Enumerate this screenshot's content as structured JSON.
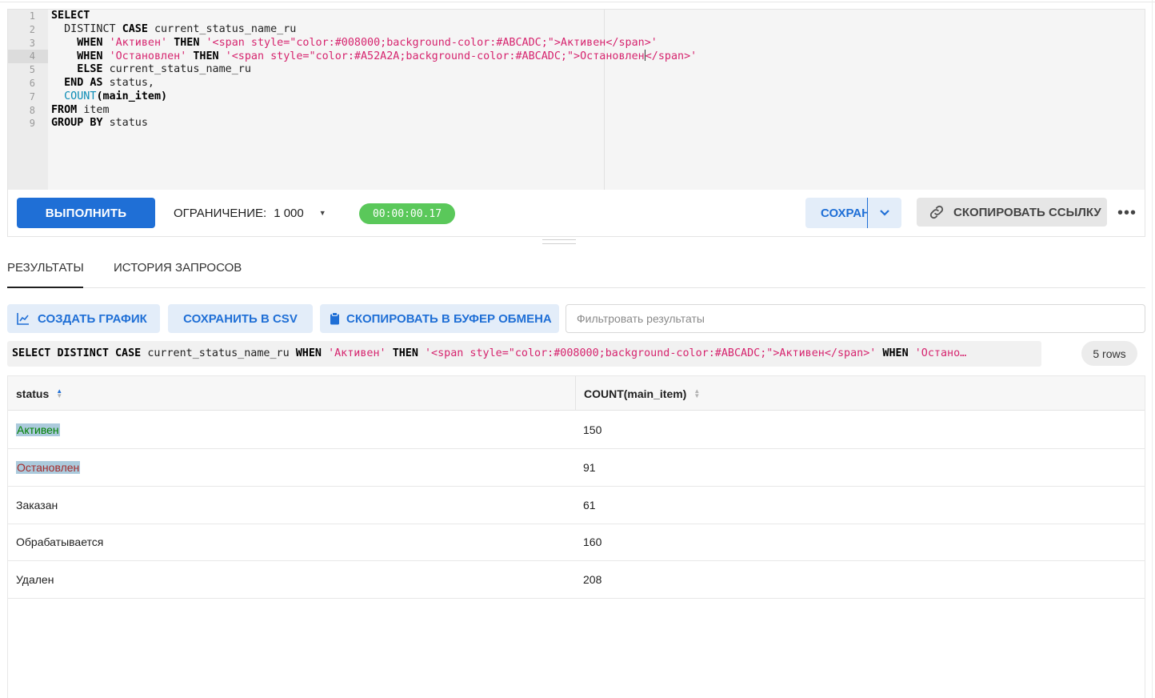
{
  "editor": {
    "line_numbers": [
      "1",
      "2",
      "3",
      "4",
      "5",
      "6",
      "7",
      "8",
      "9"
    ],
    "kw": {
      "select": "SELECT",
      "case": "CASE",
      "when": "WHEN",
      "then": "THEN",
      "else": "ELSE",
      "end": "END",
      "as": "AS",
      "from": "FROM",
      "group_by": "GROUP BY",
      "count": "COUNT"
    },
    "text": {
      "distinct": "DISTINCT",
      "col_status_name": "current_status_name_ru",
      "str_active": "'Активен'",
      "html_active": "'<span style=\"color:#008000;background-color:#ABCADC;\">Активен</span>'",
      "str_stopped": "'Остановлен'",
      "html_stopped_a": "'<span style=\"color:#A52A2A;background-color:#ABCADC;\">Остановлен",
      "html_stopped_b": "</span>'",
      "status_alias": "status,",
      "count_arg": "(main_item)",
      "table": "item",
      "group_col": "status"
    }
  },
  "toolbar": {
    "run_label": "ВЫПОЛНИТЬ",
    "limit_label": "ОГРАНИЧЕНИЕ:",
    "limit_value": "1 000",
    "timer": "00:00:00.17",
    "save_label": "СОХРАНИТЬ",
    "copy_link_label": "СКОПИРОВАТЬ ССЫЛКУ",
    "more": "•••"
  },
  "tabs": {
    "results": "РЕЗУЛЬТАТЫ",
    "history": "ИСТОРИЯ ЗАПРОСОВ"
  },
  "actions": {
    "chart": "СОЗДАТЬ ГРАФИК",
    "csv": "СОХРАНИТЬ В CSV",
    "clipboard": "СКОПИРОВАТЬ В БУФЕР ОБМЕНА",
    "filter_placeholder": "Фильтровать результаты"
  },
  "executed": {
    "k_select": "SELECT",
    "k_distinct": "DISTINCT",
    "k_case": "CASE",
    "col": "current_status_name_ru",
    "k_when": "WHEN",
    "s_active": "'Активен'",
    "k_then": "THEN",
    "html_active": "'<span style=\"color:#008000;background-color:#ABCADC;\">Активен</span>'",
    "k_when2": "WHEN",
    "s_stopped_trunc": "'Остано…"
  },
  "rows_badge": "5 rows",
  "table": {
    "columns": [
      "status",
      "COUNT(main_item)"
    ],
    "rows": [
      {
        "status": "Активен",
        "count": "150"
      },
      {
        "status": "Остановлен",
        "count": "91"
      },
      {
        "status": "Заказан",
        "count": "61"
      },
      {
        "status": "Обрабатывается",
        "count": "160"
      },
      {
        "status": "Удален",
        "count": "208"
      }
    ]
  },
  "colors": {
    "accent": "#1f6fd6",
    "timer_green": "#5ac85a",
    "active_fg": "#008000",
    "stopped_fg": "#A52A2A",
    "status_bg": "#ABCADC",
    "sql_string": "#d6246e"
  }
}
